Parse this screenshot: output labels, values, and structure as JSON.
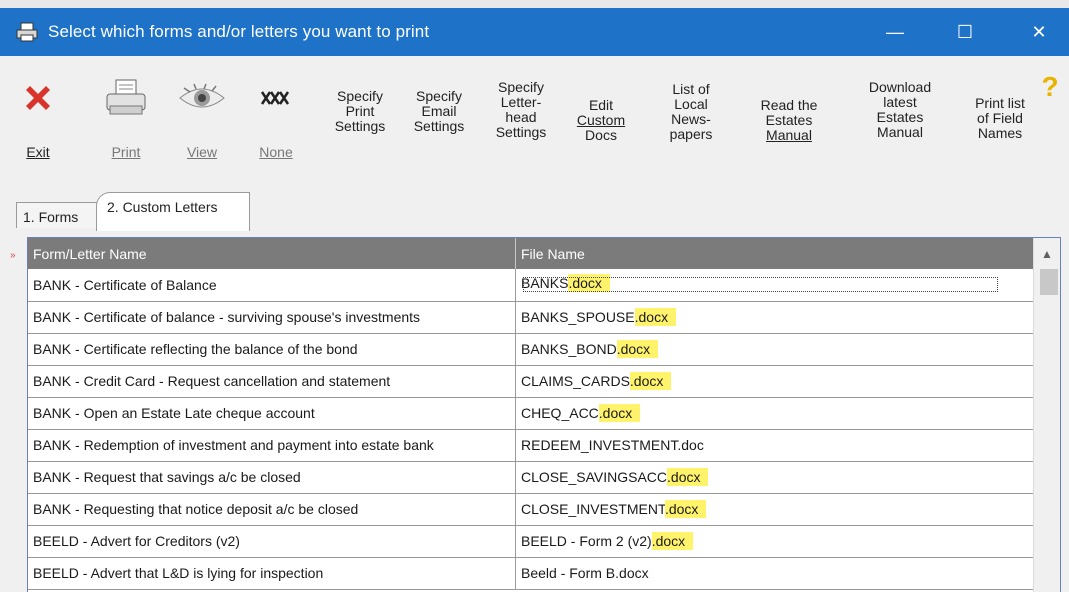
{
  "window": {
    "title": "Select which forms and/or letters you want to print",
    "minimize_glyph": "—",
    "maximize_glyph": "☐",
    "close_glyph": "✕"
  },
  "toolbar": {
    "exit": [
      "Exit"
    ],
    "print": [
      "Print"
    ],
    "view": [
      "View"
    ],
    "none": [
      "None"
    ],
    "specify_print": [
      "Specify",
      "Print",
      "Settings"
    ],
    "specify_email": [
      "Specify",
      "Email",
      "Settings"
    ],
    "letterhead": [
      "Specify",
      "Letter-",
      "head",
      "Settings"
    ],
    "edit_custom": [
      "Edit",
      "Custom",
      "Docs"
    ],
    "local_news": [
      "List of",
      "Local",
      "News-",
      "papers"
    ],
    "read_manual": [
      "Read the",
      "Estates",
      "Manual"
    ],
    "download_manual": [
      "Download",
      "latest",
      "Estates",
      "Manual"
    ],
    "print_fields": [
      "Print list",
      "of Field",
      "Names"
    ],
    "help_glyph": "?"
  },
  "tabs": {
    "forms": "1. Forms",
    "custom_letters": "2. Custom Letters"
  },
  "grid": {
    "col_name": "Form/Letter Name",
    "col_file": "File Name",
    "rows": [
      {
        "name": "BANK - Certificate of Balance",
        "file": "BANKS",
        "ext": ".docx",
        "hl": true
      },
      {
        "name": "BANK - Certificate of balance - surviving spouse's investments",
        "file": "BANKS_SPOUSE",
        "ext": ".docx",
        "hl": true
      },
      {
        "name": "BANK - Certificate reflecting the balance of the bond",
        "file": "BANKS_BOND",
        "ext": ".docx",
        "hl": true
      },
      {
        "name": "BANK - Credit Card - Request cancellation and statement",
        "file": "CLAIMS_CARDS",
        "ext": ".docx",
        "hl": true
      },
      {
        "name": "BANK - Open an Estate Late cheque account",
        "file": "CHEQ_ACC",
        "ext": ".docx",
        "hl": true
      },
      {
        "name": "BANK - Redemption of investment and payment into estate bank",
        "file": "REDEEM_INVESTMENT",
        "ext": ".doc",
        "hl": false
      },
      {
        "name": "BANK - Request that savings a/c be closed",
        "file": "CLOSE_SAVINGSACC",
        "ext": ".docx",
        "hl": true
      },
      {
        "name": "BANK - Requesting that notice deposit a/c be closed",
        "file": "CLOSE_INVESTMENT",
        "ext": ".docx",
        "hl": true
      },
      {
        "name": "BEELD - Advert for Creditors (v2)",
        "file": "BEELD - Form 2 (v2)",
        "ext": ".docx",
        "hl": true
      },
      {
        "name": "BEELD - Advert that L&D is lying for inspection",
        "file": "Beeld - Form B",
        "ext": ".docx",
        "hl": false
      }
    ]
  },
  "colors": {
    "titlebar": "#1e73c9",
    "header": "#7b7b7b",
    "highlight": "#fff36b",
    "exit_red": "#d9342b"
  }
}
